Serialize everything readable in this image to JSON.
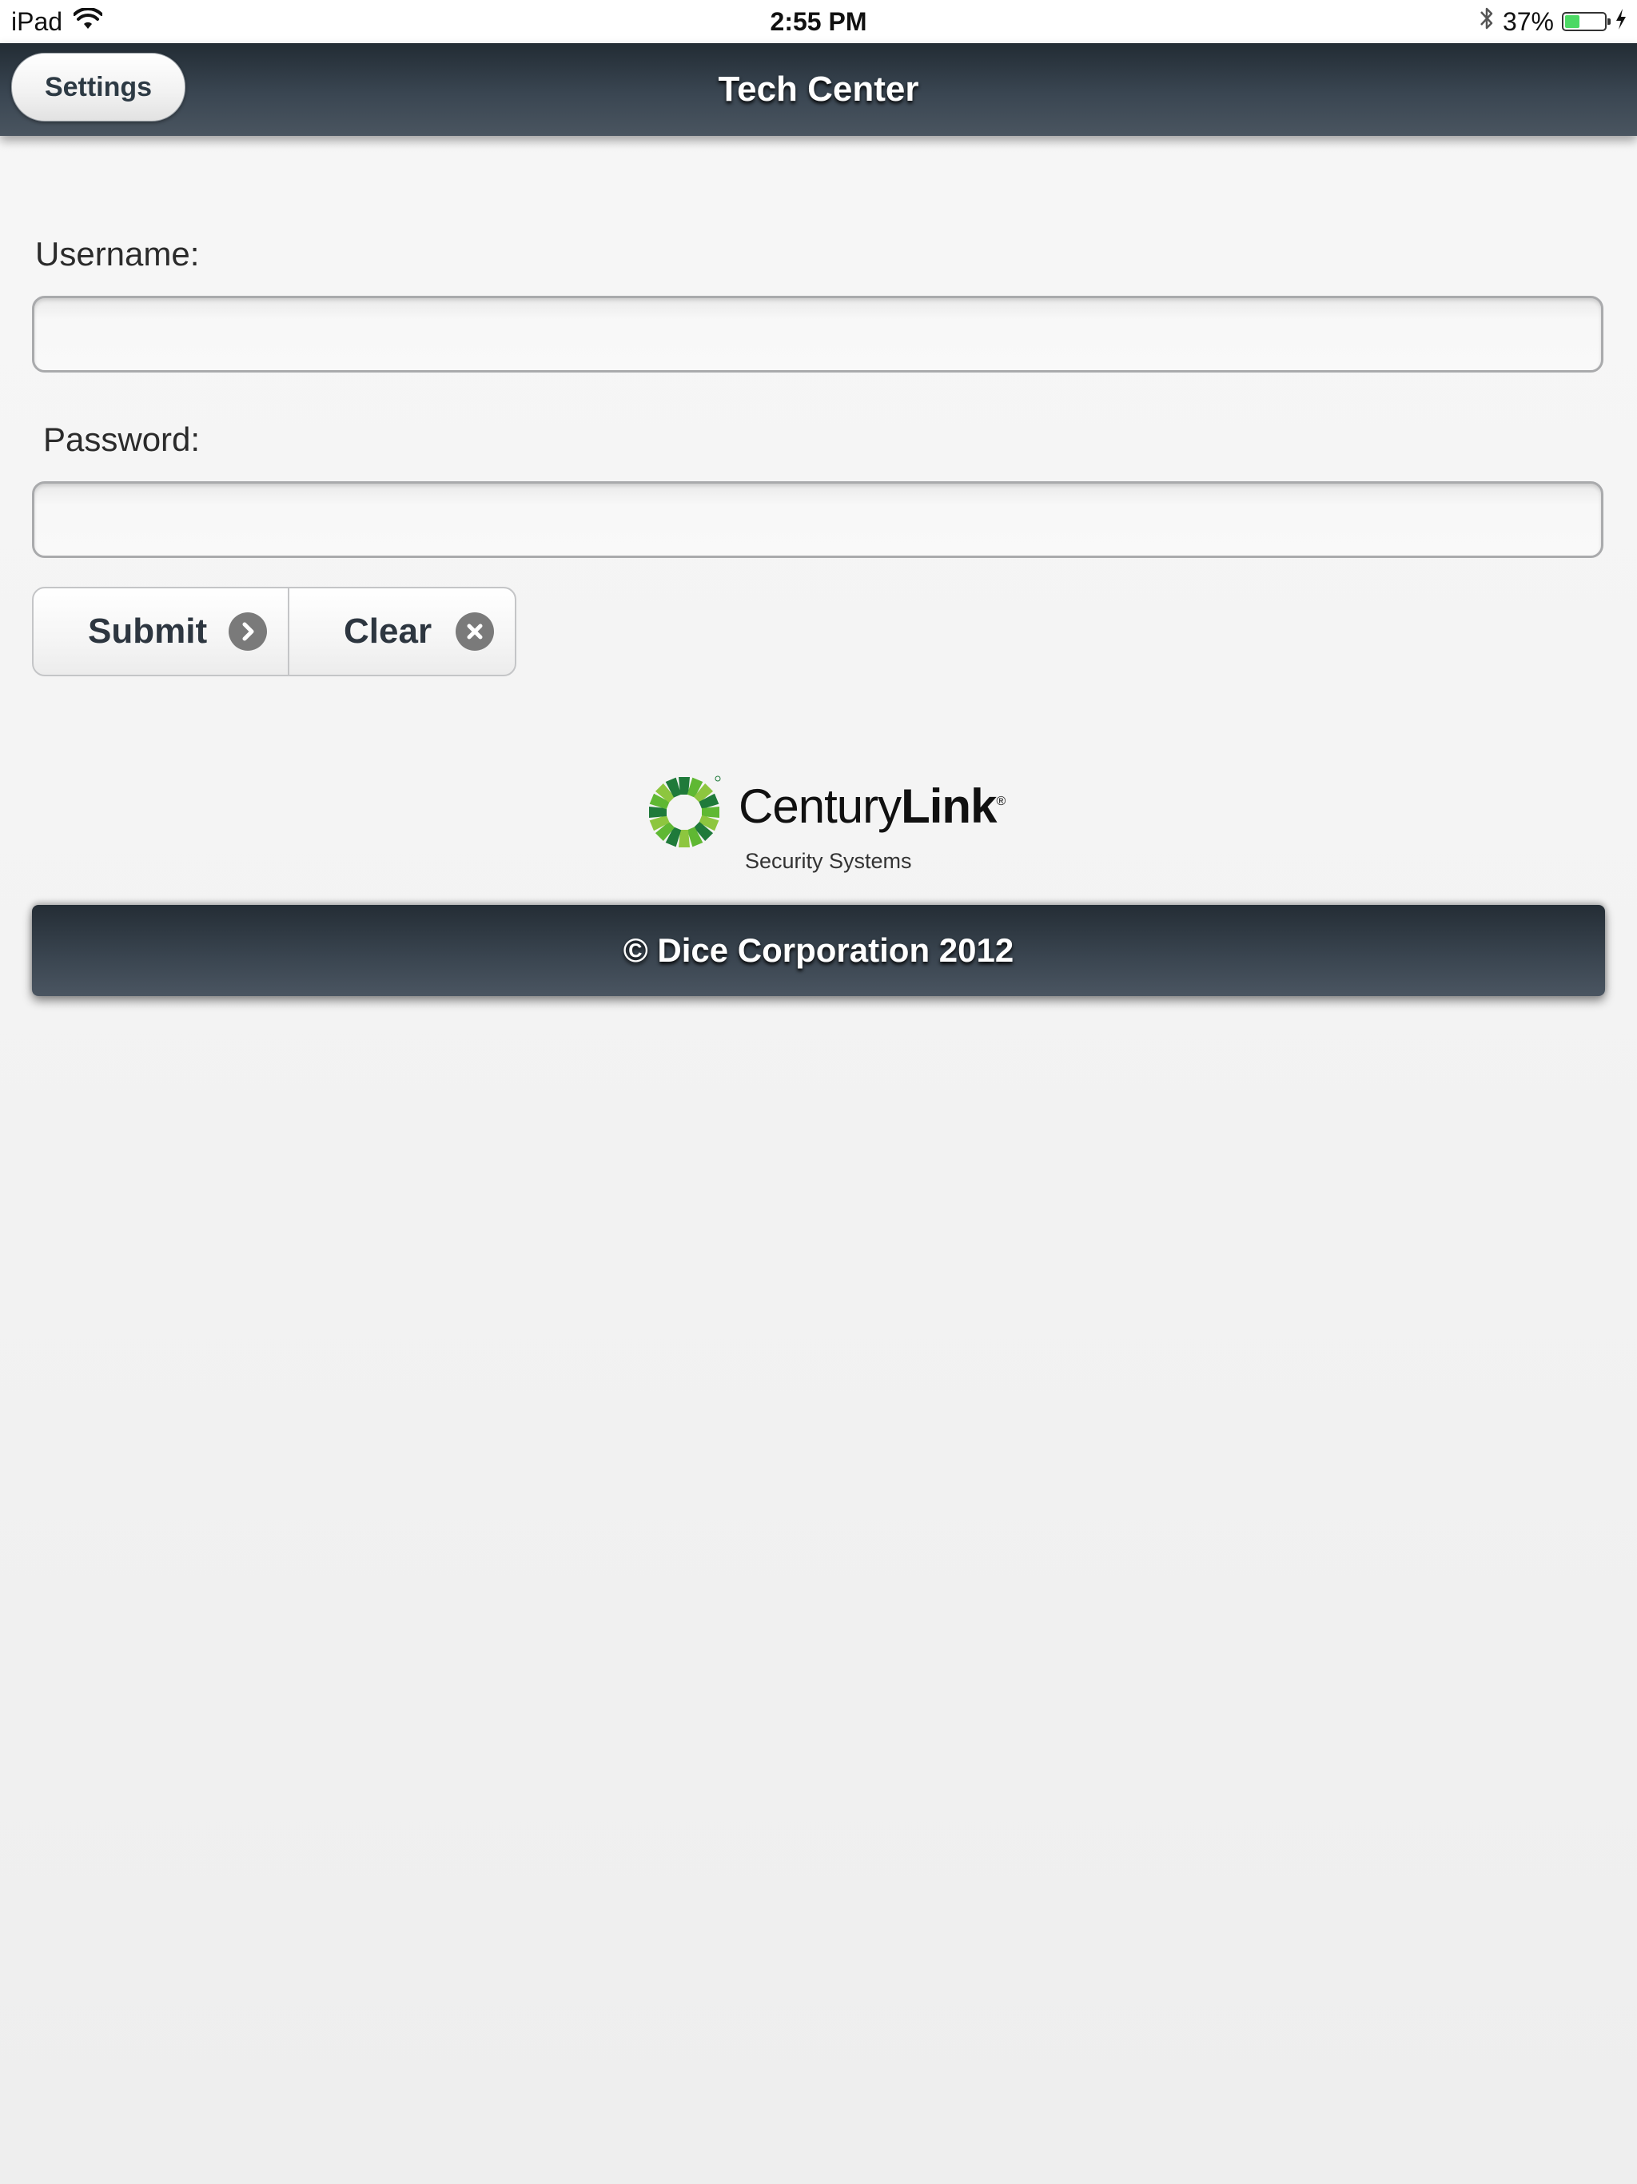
{
  "status_bar": {
    "device": "iPad",
    "time": "2:55 PM",
    "battery_percent": "37%",
    "battery_level": 0.37,
    "icons": [
      "wifi-icon",
      "bluetooth-icon",
      "battery-icon",
      "charging-bolt-icon"
    ]
  },
  "header": {
    "title": "Tech Center",
    "settings_label": "Settings"
  },
  "form": {
    "username_label": "Username:",
    "username_value": "",
    "password_label": "Password:",
    "password_value": "",
    "submit_label": "Submit",
    "submit_icon": "chevron-right-circle-icon",
    "clear_label": "Clear",
    "clear_icon": "x-circle-icon"
  },
  "logo": {
    "name_regular": "Century",
    "name_bold": "Link",
    "registered_mark": "®",
    "subtitle": "Security Systems",
    "brand_colors": [
      "#1f7a3a",
      "#5fb833",
      "#8dc63f"
    ]
  },
  "footer": {
    "copyright": "© Dice Corporation 2012"
  }
}
